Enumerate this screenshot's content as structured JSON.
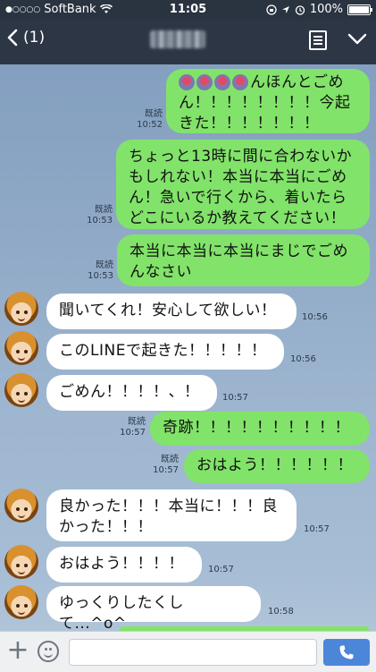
{
  "status_bar": {
    "signal_dots": "●○○○○",
    "carrier": "SoftBank",
    "time": "11:05",
    "battery": "100%"
  },
  "nav": {
    "back_count": "(1)"
  },
  "messages": [
    {
      "side": "me",
      "text": "んほんとごめん！！！！！！！！今起きた！！！！！！！",
      "meta1": "既読",
      "meta2": "10:52"
    },
    {
      "side": "me",
      "text": "ちょっと13時に間に合わないかもしれない！本当に本当にごめん！急いで行くから、着いたらどこにいるか教えてください！",
      "meta1": "既読",
      "meta2": "10:53"
    },
    {
      "side": "me",
      "text": "本当に本当に本当にまじでごめんなさい",
      "meta1": "既読",
      "meta2": "10:53"
    },
    {
      "side": "them",
      "text": "聞いてくれ！安心して欲しい！",
      "meta": "10:56"
    },
    {
      "side": "them",
      "text": "このLINEで起きた！！！！！",
      "meta": "10:56"
    },
    {
      "side": "them",
      "text": "ごめん！！！！、！",
      "meta": "10:57"
    },
    {
      "side": "me",
      "text": "奇跡！！！！！！！！！！",
      "meta1": "既読",
      "meta2": "10:57"
    },
    {
      "side": "me",
      "text": "おはよう！！！！！！",
      "meta1": "既読",
      "meta2": "10:57"
    },
    {
      "side": "them",
      "text": "良かった！！！本当に！！！良かった！！！",
      "meta": "10:57"
    },
    {
      "side": "them",
      "text": "おはよう！！！！",
      "meta": "10:57"
    },
    {
      "side": "them",
      "text": "ゆっくりしたくして...^o^",
      "meta": "10:58"
    }
  ],
  "colors": {
    "my_bubble": "#82e36a",
    "their_bubble": "#ffffff",
    "send_button": "#4c86d8"
  }
}
